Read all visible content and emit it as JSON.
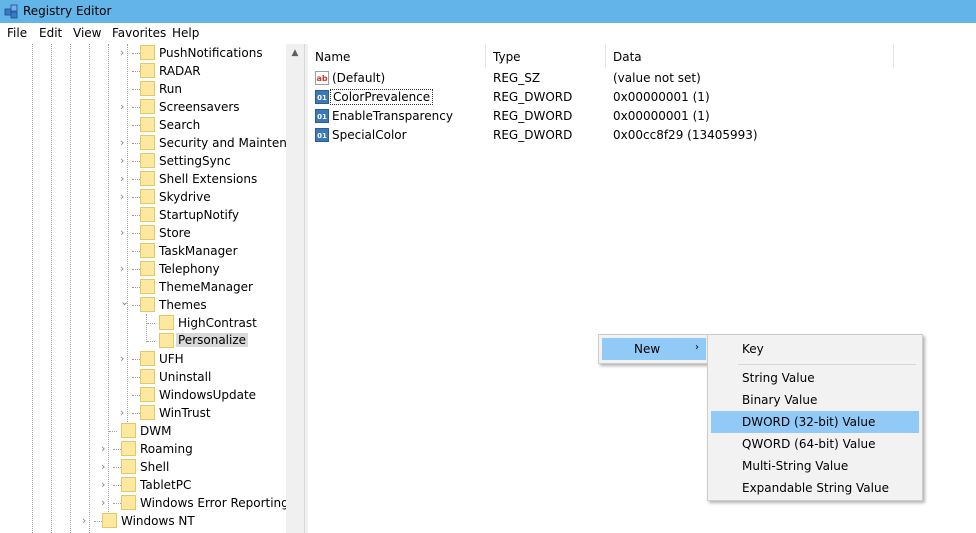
{
  "window": {
    "title": "Registry Editor"
  },
  "menubar": {
    "items": [
      "File",
      "Edit",
      "View",
      "Favorites",
      "Help"
    ]
  },
  "tree": {
    "nodes": [
      {
        "label": "PushNotifications",
        "expander": "›"
      },
      {
        "label": "RADAR",
        "expander": ""
      },
      {
        "label": "Run",
        "expander": ""
      },
      {
        "label": "Screensavers",
        "expander": "›"
      },
      {
        "label": "Search",
        "expander": ""
      },
      {
        "label": "Security and Maintenan",
        "expander": "›"
      },
      {
        "label": "SettingSync",
        "expander": "›"
      },
      {
        "label": "Shell Extensions",
        "expander": "›"
      },
      {
        "label": "Skydrive",
        "expander": "›"
      },
      {
        "label": "StartupNotify",
        "expander": ""
      },
      {
        "label": "Store",
        "expander": "›"
      },
      {
        "label": "TaskManager",
        "expander": ""
      },
      {
        "label": "Telephony",
        "expander": "›"
      },
      {
        "label": "ThemeManager",
        "expander": ""
      },
      {
        "label": "Themes",
        "expander": "⌄"
      },
      {
        "label": "HighContrast",
        "expander": ""
      },
      {
        "label": "Personalize",
        "expander": ""
      },
      {
        "label": "UFH",
        "expander": "›"
      },
      {
        "label": "Uninstall",
        "expander": ""
      },
      {
        "label": "WindowsUpdate",
        "expander": ""
      },
      {
        "label": "WinTrust",
        "expander": "›"
      },
      {
        "label": "DWM",
        "expander": ""
      },
      {
        "label": "Roaming",
        "expander": "›"
      },
      {
        "label": "Shell",
        "expander": "›"
      },
      {
        "label": "TabletPC",
        "expander": "›"
      },
      {
        "label": "Windows Error Reporting",
        "expander": "›"
      },
      {
        "label": "Windows NT",
        "expander": "›"
      }
    ]
  },
  "values": {
    "columns": {
      "name": "Name",
      "type": "Type",
      "data": "Data"
    },
    "rows": [
      {
        "icon": "ab",
        "name": "(Default)",
        "type": "REG_SZ",
        "data": "(value not set)"
      },
      {
        "icon": "bin",
        "name": "ColorPrevalence",
        "type": "REG_DWORD",
        "data": "0x00000001 (1)"
      },
      {
        "icon": "bin",
        "name": "EnableTransparency",
        "type": "REG_DWORD",
        "data": "0x00000001 (1)"
      },
      {
        "icon": "bin",
        "name": "SpecialColor",
        "type": "REG_DWORD",
        "data": "0x00cc8f29 (13405993)"
      }
    ]
  },
  "context_menu": {
    "new_label": "New",
    "arrow": "›"
  },
  "submenu": {
    "items": [
      "Key",
      "String Value",
      "Binary Value",
      "DWORD (32-bit) Value",
      "QWORD (64-bit) Value",
      "Multi-String Value",
      "Expandable String Value"
    ]
  },
  "icons": {
    "ab": "ab",
    "bin": "011\n110",
    "scroll_up": "▲"
  },
  "colors": {
    "titlebar": "#63b4e8",
    "highlight": "#91c9f7",
    "folder": "#fde8a0"
  }
}
